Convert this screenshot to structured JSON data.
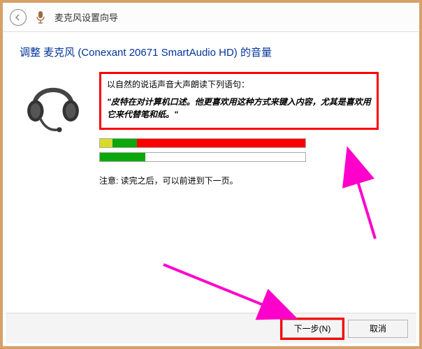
{
  "titlebar": {
    "title": "麦克风设置向导"
  },
  "heading": "调整 麦克风 (Conexant 20671 SmartAudio HD) 的音量",
  "instruction": {
    "line": "以自然的说话声音大声朗读下列语句：",
    "quote": "\"皮特在对计算机口述。他更喜欢用这种方式来键入内容，尤其是喜欢用它来代替笔和纸。\""
  },
  "note": "注意: 读完之后，可以前进到下一页。",
  "buttons": {
    "next": "下一步(N)",
    "cancel": "取消"
  }
}
